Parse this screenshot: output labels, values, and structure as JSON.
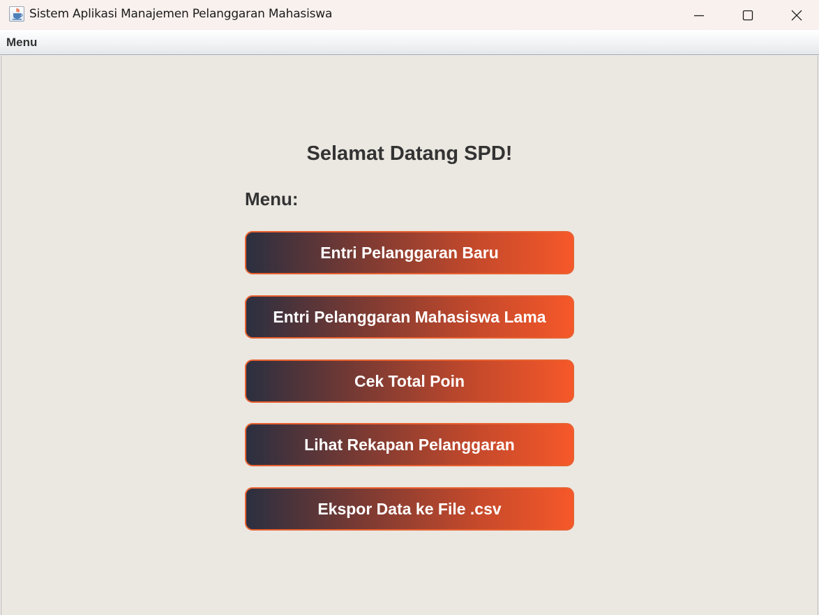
{
  "window": {
    "title": "Sistem Aplikasi Manajemen Pelanggaran Mahasiswa",
    "icon": "java-coffee-icon",
    "controls": [
      "minimize-icon",
      "maximize-icon",
      "close-icon"
    ]
  },
  "menubar": {
    "items": [
      {
        "label": "Menu"
      }
    ]
  },
  "main": {
    "welcome": "Selamat Datang SPD!",
    "menu_label": "Menu:",
    "buttons": [
      {
        "label": "Entri Pelanggaran Baru"
      },
      {
        "label": "Entri Pelanggaran Mahasiswa Lama"
      },
      {
        "label": "Cek Total Poin"
      },
      {
        "label": "Lihat Rekapan Pelanggaran"
      },
      {
        "label": "Ekspor Data ke File .csv"
      }
    ]
  },
  "colors": {
    "content_bg": "#ebe7e1",
    "button_gradient_start": "#2b2f40",
    "button_gradient_end": "#f6582a",
    "button_border": "#e8602f",
    "text": "#333333"
  }
}
